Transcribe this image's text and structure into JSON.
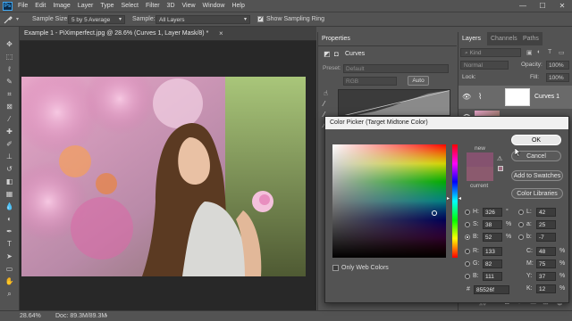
{
  "menu": {
    "logo": "Ps",
    "items": [
      "File",
      "Edit",
      "Image",
      "Layer",
      "Type",
      "Select",
      "Filter",
      "3D",
      "View",
      "Window",
      "Help"
    ],
    "window_controls": [
      "—",
      "☐",
      "✕"
    ]
  },
  "options": {
    "sample_size_label": "Sample Size:",
    "sample_size_value": "5 by 5 Average",
    "sample_label": "Sample:",
    "sample_value": "All Layers",
    "show_ring_label": "Show Sampling Ring",
    "show_ring_checked": true
  },
  "document": {
    "tab_title": "Example 1 - PiXimperfect.jpg @ 28.6% (Curves 1, Layer Mask/8) *",
    "close_symbol": "×"
  },
  "status": {
    "zoom": "28.64%",
    "doc_size": "Doc: 89.3M/89.3M"
  },
  "properties": {
    "tab_label": "Properties",
    "panel_title": "Curves",
    "preset_label": "Preset:",
    "preset_value": "Default",
    "channel_value": "RGB",
    "auto_label": "Auto"
  },
  "layers": {
    "tabs": [
      "Layers",
      "Channels",
      "Paths"
    ],
    "kind_label": "Kind",
    "blend_mode": "Normal",
    "opacity_label": "Opacity:",
    "opacity_value": "100%",
    "fill_label": "Fill:",
    "fill_value": "100%",
    "lock_label": "Lock:",
    "layer_name": "Curves 1"
  },
  "picker": {
    "title": "Color Picker (Target Midtone Color)",
    "new_label": "new",
    "current_label": "current",
    "new_color": "#85526f",
    "current_color": "#8b5a6e",
    "ok_label": "OK",
    "cancel_label": "Cancel",
    "add_swatches_label": "Add to Swatches",
    "color_libraries_label": "Color Libraries",
    "only_web_label": "Only Web Colors",
    "fields": {
      "h_label": "H:",
      "h_value": "326",
      "h_unit": "°",
      "s_label": "S:",
      "s_value": "38",
      "s_unit": "%",
      "b_label": "B:",
      "b_value": "52",
      "b_unit": "%",
      "r_label": "R:",
      "r_value": "133",
      "g_label": "G:",
      "g_value": "82",
      "bl_label": "B:",
      "bl_value": "111",
      "l_label": "L:",
      "l_value": "42",
      "a_label": "a:",
      "a_value": "25",
      "lb_label": "b:",
      "lb_value": "-7",
      "c_label": "C:",
      "c_value": "48",
      "c_unit": "%",
      "m_label": "M:",
      "m_value": "75",
      "m_unit": "%",
      "y_label": "Y:",
      "y_value": "37",
      "y_unit": "%",
      "k_label": "K:",
      "k_value": "12",
      "k_unit": "%",
      "hex_label": "#",
      "hex_value": "85526f"
    }
  },
  "colors": {
    "ui_bg": "#535353",
    "accent_blue": "#3fa9f5"
  }
}
